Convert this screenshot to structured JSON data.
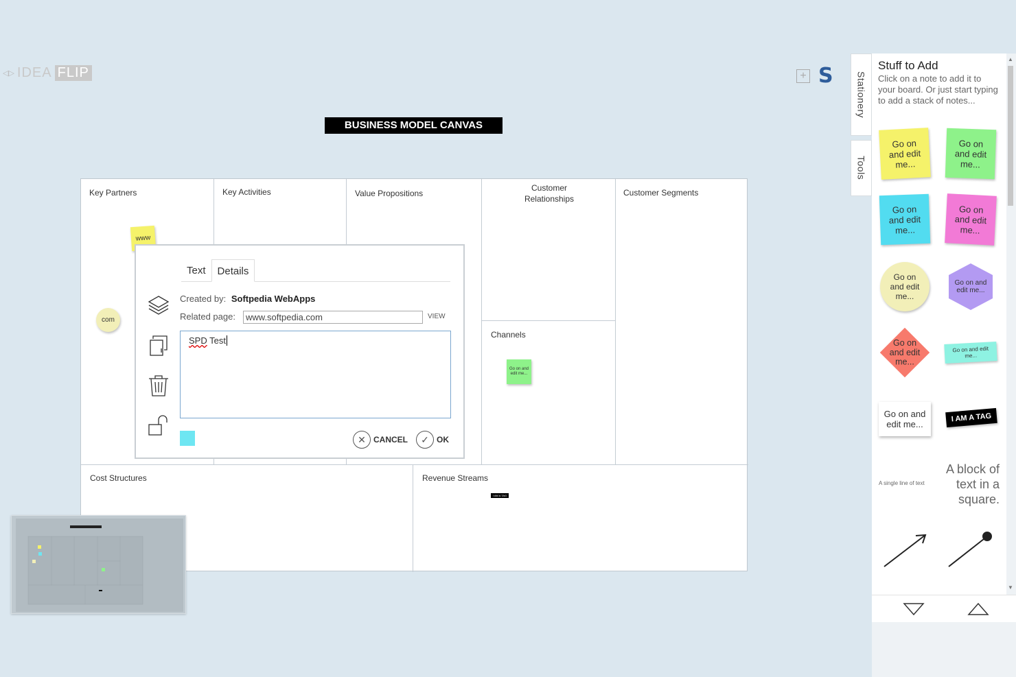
{
  "logo": {
    "arrows": "◁▷",
    "part1": "IDEA",
    "part2": "FLIP"
  },
  "board": {
    "title": "BUSINESS MODEL CANVAS",
    "sections": {
      "key_partners": "Key Partners",
      "key_activities": "Key Activities",
      "value_propositions": "Value Propositions",
      "customer_relationships": "Customer Relationships",
      "customer_segments": "Customer Segments",
      "channels": "Channels",
      "cost_structures": "Cost Structures",
      "revenue_streams": "Revenue Streams"
    },
    "notes": {
      "www": "www",
      "com": "com",
      "channels_note": "Go on and edit me...",
      "tag": "I AM A TAG"
    }
  },
  "dialog": {
    "tabs": [
      "Text",
      "Details"
    ],
    "active_tab": "Details",
    "created_by_label": "Created by:",
    "created_by_value": "Softpedia WebApps",
    "related_page_label": "Related page:",
    "related_page_value": "www.softpedia.com",
    "view_label": "VIEW",
    "text_word1": "SPD",
    "text_word2": "Test",
    "cancel_label": "CANCEL",
    "ok_label": "OK",
    "swatch_color": "#6ee6f2"
  },
  "side_tabs": [
    "Stationery",
    "Tools"
  ],
  "panel": {
    "title": "Stuff to Add",
    "description": "Click on a note to add it to your board. Or just start typing to add a stack of notes...",
    "items": [
      {
        "text": "Go on and edit me...",
        "color": "#f5f26a"
      },
      {
        "text": "Go on and edit me...",
        "color": "#8ef28a"
      },
      {
        "text": "Go on and edit me...",
        "color": "#52dcf0"
      },
      {
        "text": "Go on and edit me...",
        "color": "#f27ad6"
      },
      {
        "text": "Go on and edit me...",
        "color": "#f2efb8"
      },
      {
        "text": "Go on and edit me...",
        "color": "#b39af2"
      },
      {
        "text": "Go on and edit me...",
        "color": "#f77a6c"
      },
      {
        "text": "Go on and edit me...",
        "color": "#8ef2e2"
      },
      {
        "text": "Go on and edit me...",
        "color": "#ffffff"
      },
      {
        "text": "I AM A TAG",
        "color": "#000000"
      },
      {
        "text": "A single line of text"
      },
      {
        "text": "A block of text in a square."
      }
    ]
  }
}
